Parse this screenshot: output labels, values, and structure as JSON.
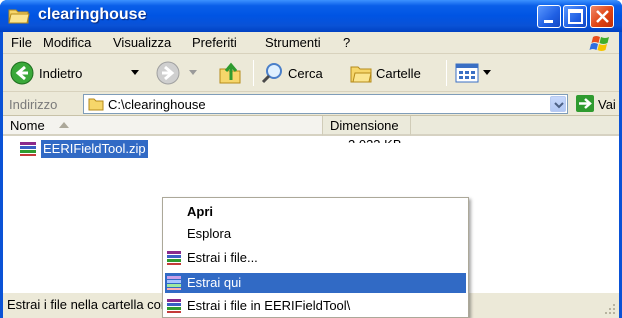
{
  "window": {
    "title": "clearinghouse",
    "controls": [
      "minimize",
      "maximize",
      "close"
    ]
  },
  "menubar": {
    "items": [
      "File",
      "Modifica",
      "Visualizza",
      "Preferiti",
      "Strumenti",
      "?"
    ]
  },
  "toolbar": {
    "back_label": "Indietro",
    "search_label": "Cerca",
    "folders_label": "Cartelle"
  },
  "address": {
    "label": "Indirizzo",
    "value": "C:\\clearinghouse",
    "go_label": "Vai"
  },
  "filelist": {
    "columns": [
      "Nome",
      "Dimensione"
    ],
    "sorted_column": "Nome",
    "files": [
      {
        "name": "EERIFieldTool.zip",
        "size": "2.033 KB",
        "selected": true
      }
    ]
  },
  "statusbar": {
    "text": "Estrai i file nella cartella corrente"
  },
  "context_menu": {
    "items": [
      {
        "label": "Apri",
        "bold": true,
        "icon": ""
      },
      {
        "label": "Esplora",
        "bold": false,
        "icon": ""
      },
      {
        "label": "Estrai i file...",
        "bold": false,
        "icon": "winrar-icon"
      },
      {
        "label": "Estrai qui",
        "bold": false,
        "icon": "winrar-icon",
        "highlighted": true
      },
      {
        "label": "Estrai i file in EERIFieldTool\\",
        "bold": false,
        "icon": "winrar-icon"
      }
    ]
  },
  "colors": {
    "titlebar": "#0054e3",
    "selection": "#316ac5",
    "chrome": "#ece9d8"
  }
}
